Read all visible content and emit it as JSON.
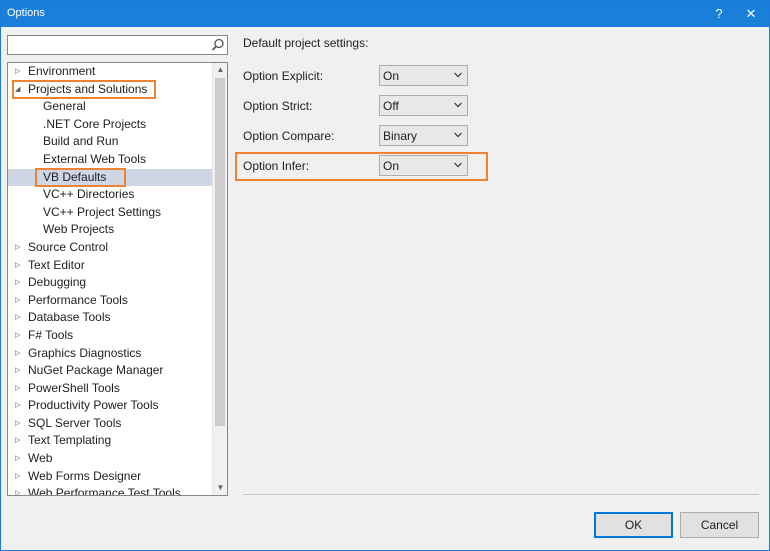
{
  "window": {
    "title": "Options",
    "help_label": "?",
    "close_label": "✕"
  },
  "search": {
    "value": "",
    "placeholder": ""
  },
  "tree": {
    "items": [
      {
        "label": "Environment",
        "level": 0,
        "expanded": false
      },
      {
        "label": "Projects and Solutions",
        "level": 0,
        "expanded": true,
        "highlighted": true
      },
      {
        "label": "General",
        "level": 1
      },
      {
        "label": ".NET Core Projects",
        "level": 1
      },
      {
        "label": "Build and Run",
        "level": 1
      },
      {
        "label": "External Web Tools",
        "level": 1
      },
      {
        "label": "VB Defaults",
        "level": 1,
        "selected": true,
        "highlighted": true
      },
      {
        "label": "VC++ Directories",
        "level": 1
      },
      {
        "label": "VC++ Project Settings",
        "level": 1
      },
      {
        "label": "Web Projects",
        "level": 1
      },
      {
        "label": "Source Control",
        "level": 0,
        "expanded": false
      },
      {
        "label": "Text Editor",
        "level": 0,
        "expanded": false
      },
      {
        "label": "Debugging",
        "level": 0,
        "expanded": false
      },
      {
        "label": "Performance Tools",
        "level": 0,
        "expanded": false
      },
      {
        "label": "Database Tools",
        "level": 0,
        "expanded": false
      },
      {
        "label": "F# Tools",
        "level": 0,
        "expanded": false
      },
      {
        "label": "Graphics Diagnostics",
        "level": 0,
        "expanded": false
      },
      {
        "label": "NuGet Package Manager",
        "level": 0,
        "expanded": false
      },
      {
        "label": "PowerShell Tools",
        "level": 0,
        "expanded": false
      },
      {
        "label": "Productivity Power Tools",
        "level": 0,
        "expanded": false
      },
      {
        "label": "SQL Server Tools",
        "level": 0,
        "expanded": false
      },
      {
        "label": "Text Templating",
        "level": 0,
        "expanded": false
      },
      {
        "label": "Web",
        "level": 0,
        "expanded": false
      },
      {
        "label": "Web Forms Designer",
        "level": 0,
        "expanded": false
      },
      {
        "label": "Web Performance Test Tools",
        "level": 0,
        "expanded": false
      }
    ]
  },
  "settings": {
    "heading": "Default project settings:",
    "options": [
      {
        "label": "Option Explicit:",
        "value": "On"
      },
      {
        "label": "Option Strict:",
        "value": "Off"
      },
      {
        "label": "Option Compare:",
        "value": "Binary"
      },
      {
        "label": "Option Infer:",
        "value": "On",
        "highlighted": true
      }
    ]
  },
  "buttons": {
    "ok": "OK",
    "cancel": "Cancel"
  },
  "colors": {
    "titlebar": "#1a7fd9",
    "highlight": "#ee8433",
    "selection": "#cfd6e5",
    "primary_border": "#0078d7"
  }
}
